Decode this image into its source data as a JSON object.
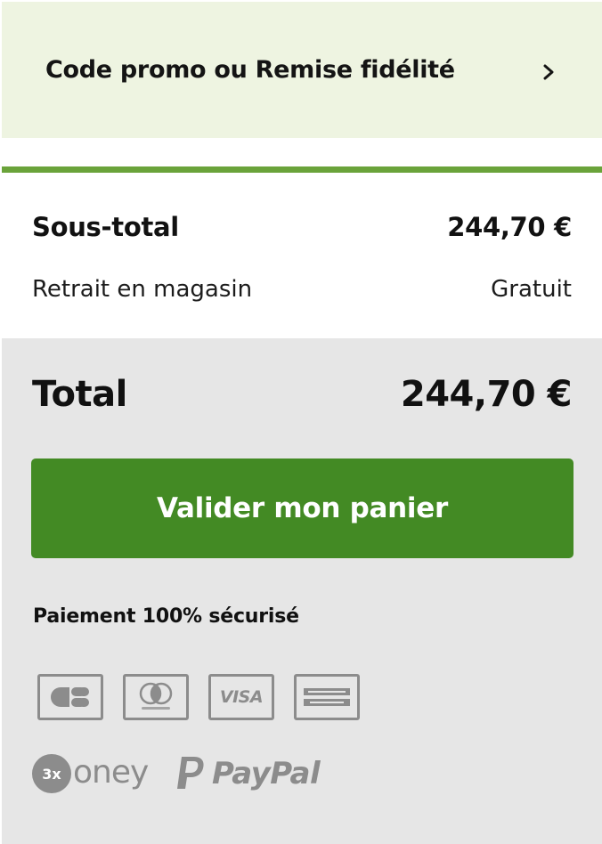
{
  "promo": {
    "label": "Code promo ou Remise fidélité",
    "chevron_icon": "chevron-right-icon"
  },
  "summary": {
    "subtotal_label": "Sous-total",
    "subtotal_value": "244,70 €",
    "pickup_label": "Retrait en magasin",
    "pickup_value": "Gratuit"
  },
  "total": {
    "label": "Total",
    "value": "244,70 €"
  },
  "checkout": {
    "button_label": "Valider mon panier"
  },
  "payment": {
    "secure_label": "Paiement 100% sécurisé",
    "methods": [
      {
        "icon": "carte-bancaire-icon"
      },
      {
        "icon": "mastercard-icon"
      },
      {
        "icon": "visa-icon",
        "text": "VISA"
      },
      {
        "icon": "american-express-icon"
      },
      {
        "icon": "oney-icon",
        "badge": "3x",
        "text": "oney"
      },
      {
        "icon": "paypal-icon",
        "text": "PayPal"
      }
    ]
  },
  "colors": {
    "promo_bg": "#eef4e1",
    "accent_green": "#6aa33a",
    "button_green": "#438a24",
    "panel_gray": "#e6e6e6",
    "logo_gray": "#8c8c8c"
  }
}
